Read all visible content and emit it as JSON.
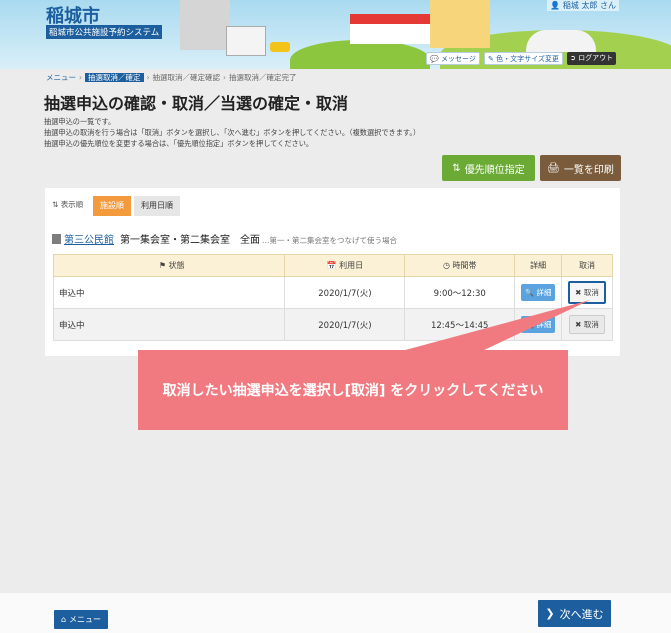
{
  "header": {
    "city": "稲城市",
    "system_name": "稲城市公共施設予約システム",
    "user": "稲城 太郎 さん",
    "message_label": "メッセージ",
    "text_size_label": "色・文字サイズ変更",
    "logout_label": "ログアウト"
  },
  "breadcrumb": [
    "メニュー",
    "抽選取消／確定",
    "抽選取消／確定確認",
    "抽選取消／確定完了"
  ],
  "page_title": "抽選申込の確認・取消／当選の確定・取消",
  "descriptions": [
    "抽選申込の一覧です。",
    "抽選申込の取消を行う場合は「取消」ボタンを選択し、「次へ進む」ボタンを押してください。（複数選択できます。）",
    "抽選申込の優先順位を変更する場合は、「優先順位指定」ボタンを押してください。"
  ],
  "buttons": {
    "priority": "優先順位指定",
    "print": "一覧を印刷",
    "menu": "メニュー",
    "next": "次へ進む"
  },
  "sort": {
    "label": "表示順",
    "options": [
      "施設順",
      "利用日順"
    ],
    "selected": "施設順"
  },
  "facility": {
    "name": "第三公民館",
    "room": "第一集会室・第二集会室　全面",
    "note": "…第一・第二集会室をつなげて使う場合"
  },
  "table": {
    "headers": [
      "状態",
      "利用日",
      "時間帯",
      "詳細",
      "取消"
    ],
    "rows": [
      {
        "status": "申込中",
        "date": "2020/1/7(火)",
        "time": "9:00～12:30",
        "detail": "詳細",
        "cancel": "取消"
      },
      {
        "status": "申込中",
        "date": "2020/1/7(火)",
        "time": "12:45～14:45",
        "detail": "詳細",
        "cancel": "取消"
      }
    ]
  },
  "callout": "取消したい抽選申込を選択し[取消] をクリックしてください",
  "colors": {
    "brand": "#1d5f9e",
    "priority_button": "#6bab35",
    "print_button": "#7a5c3c",
    "sort_active": "#f39a3c",
    "callout": "#f07a80"
  }
}
